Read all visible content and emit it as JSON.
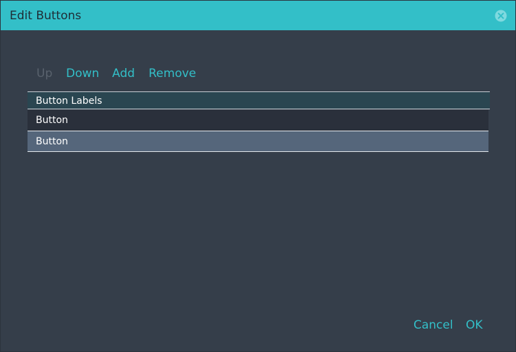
{
  "dialog": {
    "title": "Edit Buttons",
    "close_icon": "close-circle-icon"
  },
  "toolbar": {
    "up_label": "Up",
    "up_enabled": false,
    "down_label": "Down",
    "add_label": "Add",
    "remove_label": "Remove"
  },
  "table": {
    "header": "Button Labels",
    "rows": [
      {
        "label": "Button",
        "selected": false
      },
      {
        "label": "Button",
        "selected": true
      }
    ]
  },
  "footer": {
    "cancel_label": "Cancel",
    "ok_label": "OK"
  },
  "colors": {
    "accent": "#33bfc8",
    "background": "#353e4a",
    "disabled_text": "#59626d",
    "header_bg": "#2a4651",
    "row_bg": "#2a303b",
    "selected_row_bg": "#55667b"
  }
}
